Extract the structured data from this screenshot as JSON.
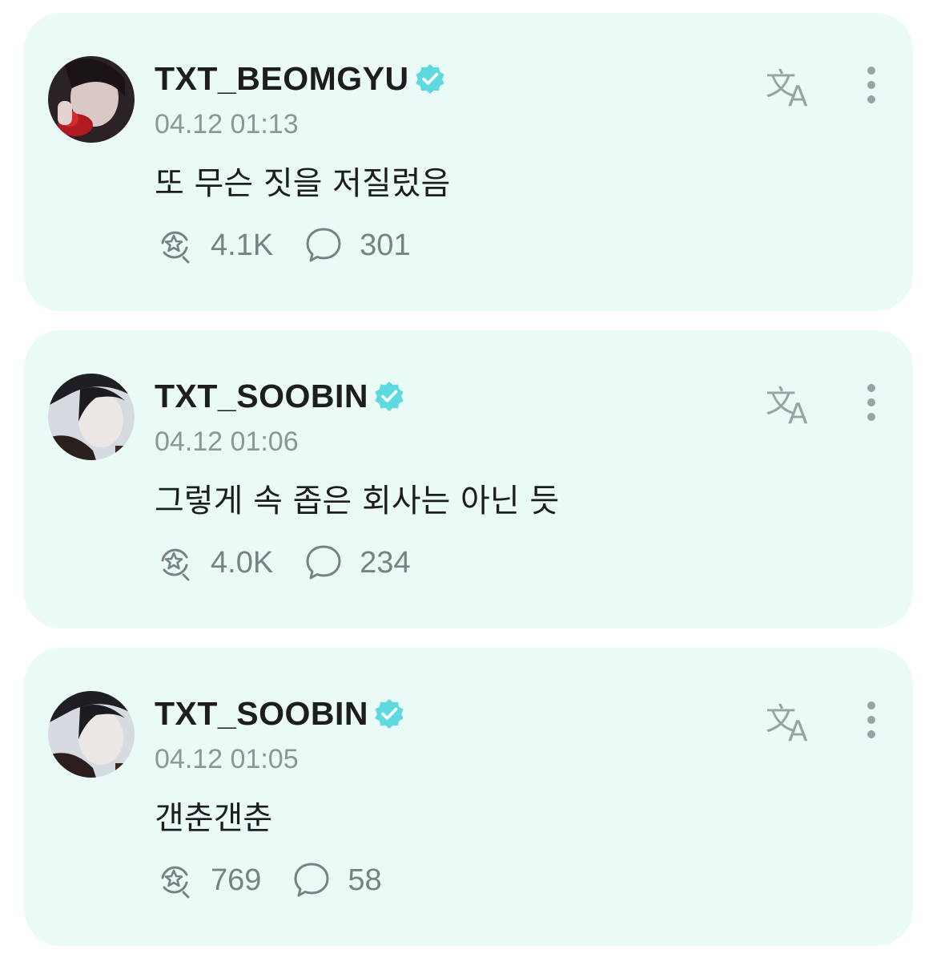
{
  "colors": {
    "card_background": "#eafaf6",
    "verified_badge": "#5fd9e0",
    "username_text": "#1d1d1f",
    "muted_text": "#8e9597"
  },
  "icons": {
    "verified": "verified-badge-icon",
    "translate": "translate-icon",
    "more": "more-vertical-icon",
    "repost": "repost-icon",
    "comment": "comment-bubble-icon"
  },
  "posts": [
    {
      "username": "TXT_BEOMGYU",
      "timestamp": "04.12 01:13",
      "text": "또 무슨 짓을 저질렀음",
      "reposts": "4.1K",
      "comments": "301"
    },
    {
      "username": "TXT_SOOBIN",
      "timestamp": "04.12 01:06",
      "text": "그렇게 속 좁은 회사는 아닌 듯",
      "reposts": "4.0K",
      "comments": "234"
    },
    {
      "username": "TXT_SOOBIN",
      "timestamp": "04.12 01:05",
      "text": "갠춘갠춘",
      "reposts": "769",
      "comments": "58"
    }
  ]
}
